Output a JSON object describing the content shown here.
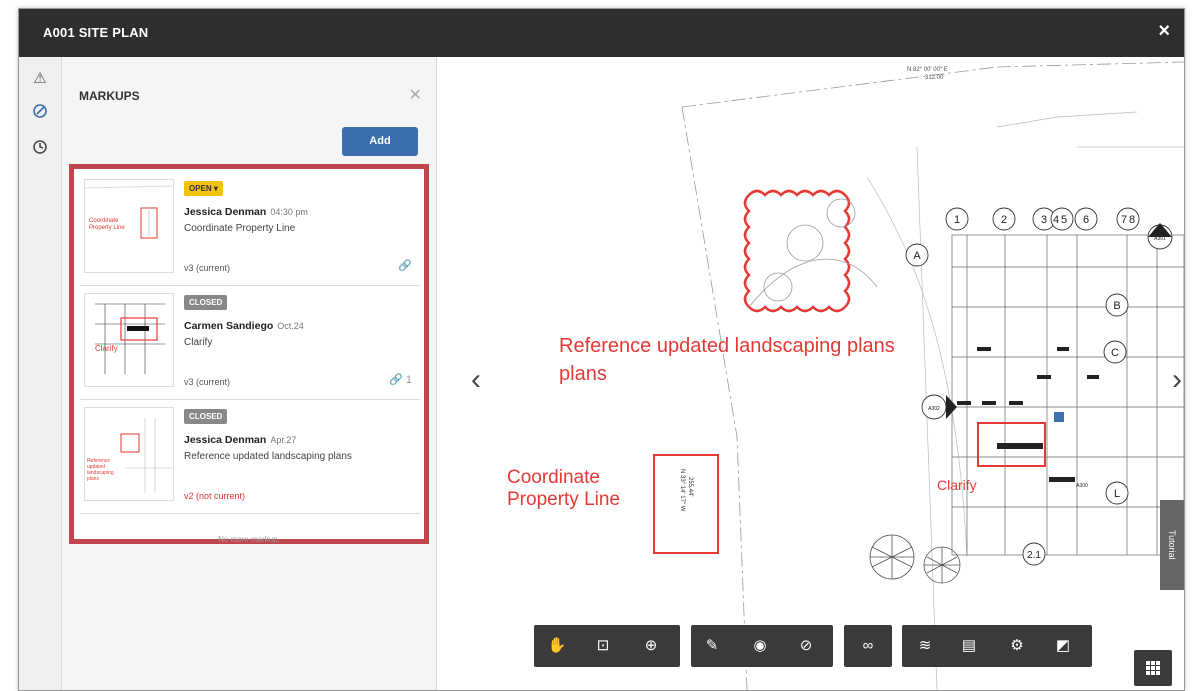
{
  "window": {
    "title": "A001 SITE PLAN",
    "close_icon": "×"
  },
  "panel": {
    "title": "MARKUPS",
    "add_label": "Add",
    "no_more": "No more markup.",
    "markups": [
      {
        "status": "OPEN ▾",
        "author": "Jessica Denman",
        "time": "04:30 pm",
        "note": "Coordinate Property Line",
        "version": "v3 (current)",
        "attachments": ""
      },
      {
        "status": "CLOSED",
        "author": "Carmen Sandiego",
        "time": "Oct.24",
        "note": "Clarify",
        "version": "v3 (current)",
        "attachments": "1"
      },
      {
        "status": "CLOSED",
        "author": "Jessica Denman",
        "time": "Apr.27",
        "note": "Reference updated landscaping plans",
        "version": "v2 (not current)",
        "attachments": ""
      }
    ],
    "thumb_labels": {
      "t1": "Coordinate Property Line",
      "t2": "Clarify",
      "t3": "Reference updated landscaping plans"
    }
  },
  "canvas": {
    "annotation_landscaping": "Reference updated landscaping plans",
    "annotation_property": "Coordinate Property Line",
    "annotation_clarify": "Clarify",
    "bearing_top": "N 82° 00' 00\" E",
    "bearing_top_dist": "312.00'",
    "bearing_box": "N 33° 14' 17\" W",
    "bearing_box_dist": "255.44'",
    "grid_labels": [
      "1",
      "2",
      "3",
      "4",
      "5",
      "6",
      "7",
      "8",
      "A",
      "B",
      "C",
      "L",
      "2.1"
    ],
    "sheet_tags": [
      "A301",
      "A302",
      "A300"
    ],
    "tutorial_label": "Tutorial"
  },
  "colors": {
    "markup_red": "#e53935",
    "highlight_border": "#c0454d",
    "primary_blue": "#3b6fb0",
    "open_yellow": "#f4c20d"
  }
}
